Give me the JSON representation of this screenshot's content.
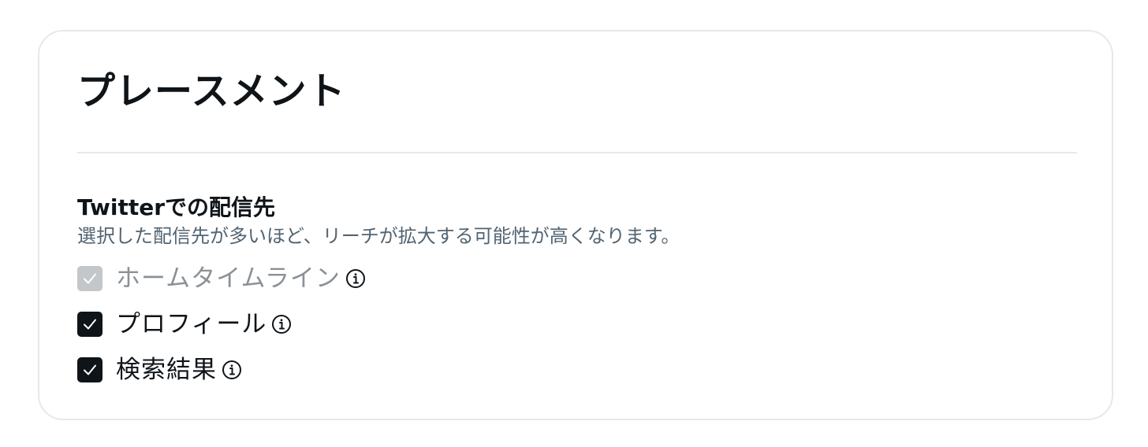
{
  "card": {
    "title": "プレースメント"
  },
  "section": {
    "title": "Twitterでの配信先",
    "description": "選択した配信先が多いほど、リーチが拡大する可能性が高くなります。"
  },
  "options": [
    {
      "label": "ホームタイムライン",
      "checked": true,
      "disabled": true,
      "icon": "info-icon"
    },
    {
      "label": "プロフィール",
      "checked": true,
      "disabled": false,
      "icon": "info-icon"
    },
    {
      "label": "検索結果",
      "checked": true,
      "disabled": false,
      "icon": "info-icon"
    }
  ],
  "colors": {
    "text_primary": "#0f1419",
    "text_secondary": "#536471",
    "disabled_text": "#8b9196",
    "checkbox_checked": "#0f1419",
    "checkbox_disabled": "#c4c7ca",
    "border": "#e6e8ea"
  }
}
